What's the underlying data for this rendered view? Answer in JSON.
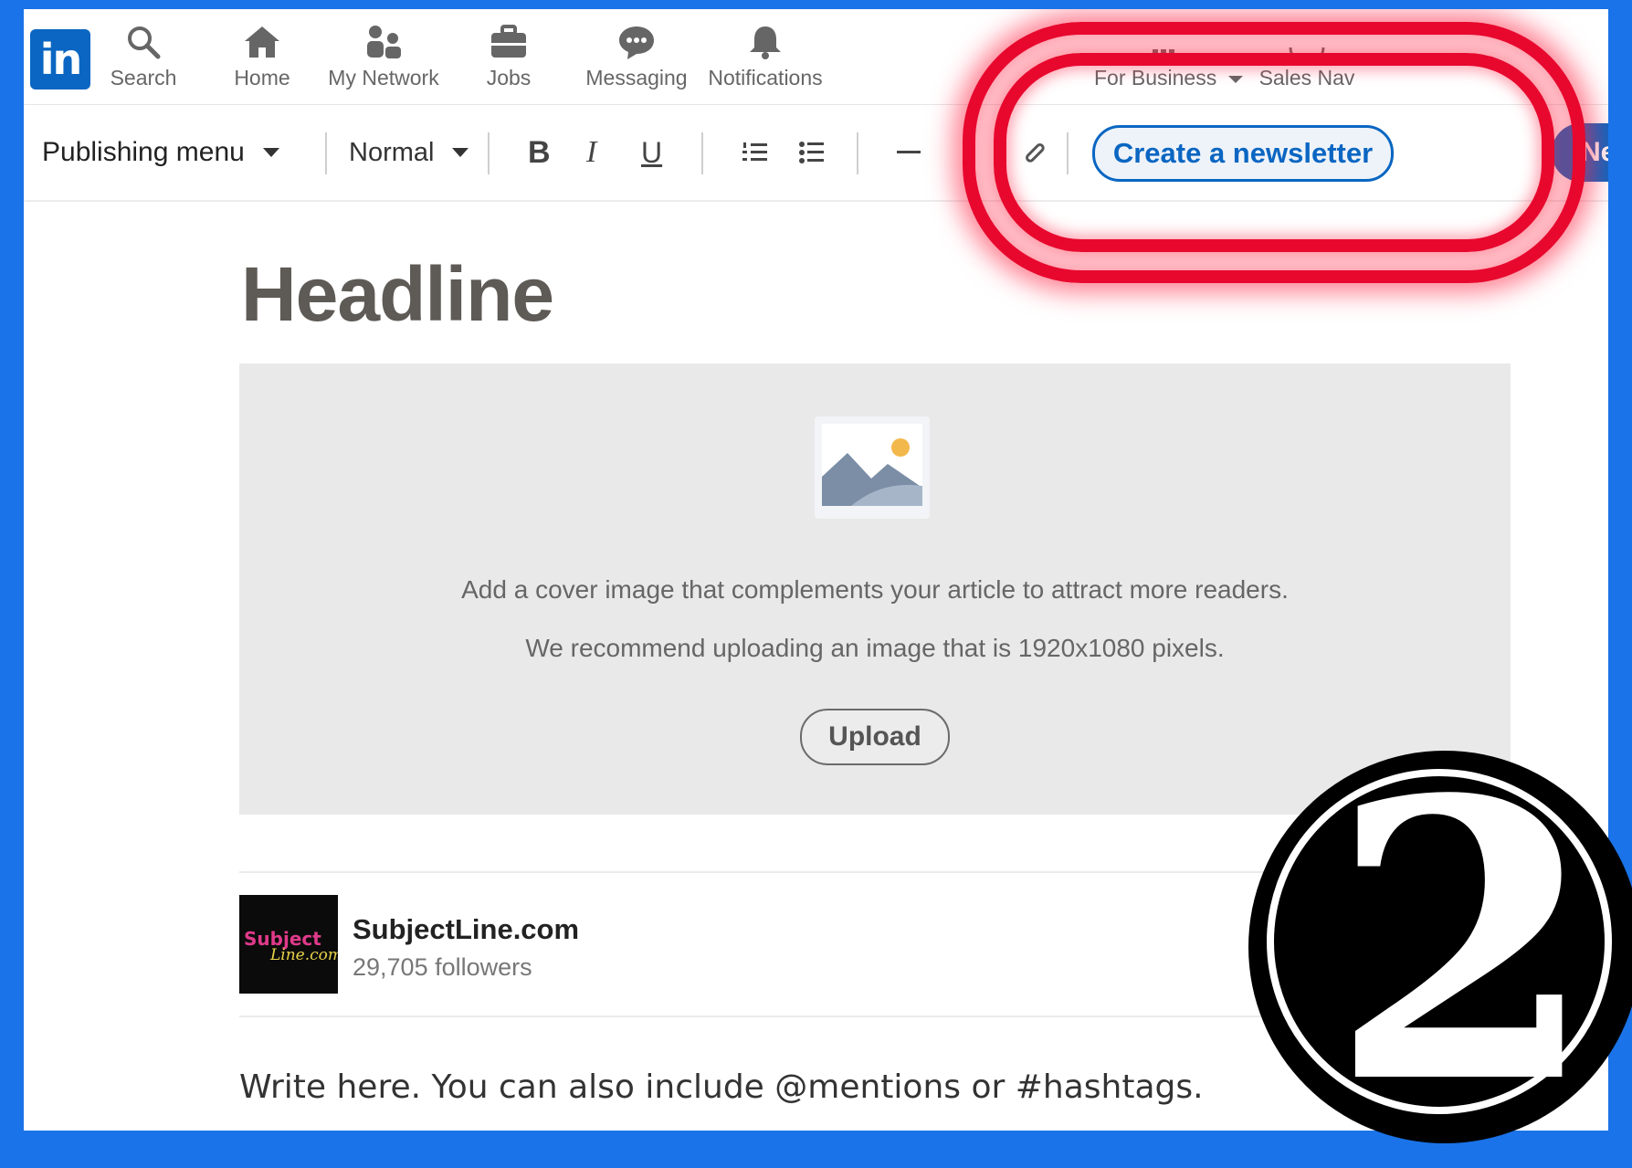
{
  "nav": {
    "items": [
      {
        "label": "Search",
        "icon": "search-icon"
      },
      {
        "label": "Home",
        "icon": "home-icon"
      },
      {
        "label": "My Network",
        "icon": "network-icon"
      },
      {
        "label": "Jobs",
        "icon": "briefcase-icon"
      },
      {
        "label": "Messaging",
        "icon": "messaging-icon"
      },
      {
        "label": "Notifications",
        "icon": "bell-icon"
      },
      {
        "label": "For Business",
        "icon": "grid-icon"
      },
      {
        "label": "Sales Nav",
        "icon": "compass-icon"
      }
    ],
    "logo": "in"
  },
  "toolbar": {
    "publishing_menu": "Publishing menu",
    "text_style": "Normal",
    "bold": "B",
    "italic": "I",
    "underline": "U",
    "create_newsletter": "Create a newsletter",
    "next": "Ne"
  },
  "editor": {
    "headline": "Headline",
    "cover_text_1": "Add a cover image that complements your article to attract more readers.",
    "cover_text_2": "We recommend uploading an image that is 1920x1080 pixels.",
    "upload": "Upload",
    "write_here": "Write here. You can also include @mentions or #hashtags."
  },
  "author": {
    "name": "SubjectLine.com",
    "followers": "29,705 followers",
    "logo_line1": "Subject",
    "logo_line2": "Line.com"
  },
  "badge": {
    "number": "2"
  },
  "colors": {
    "brand": "#0a66c2",
    "highlight": "#e8082e",
    "frame": "#1a73e8"
  }
}
